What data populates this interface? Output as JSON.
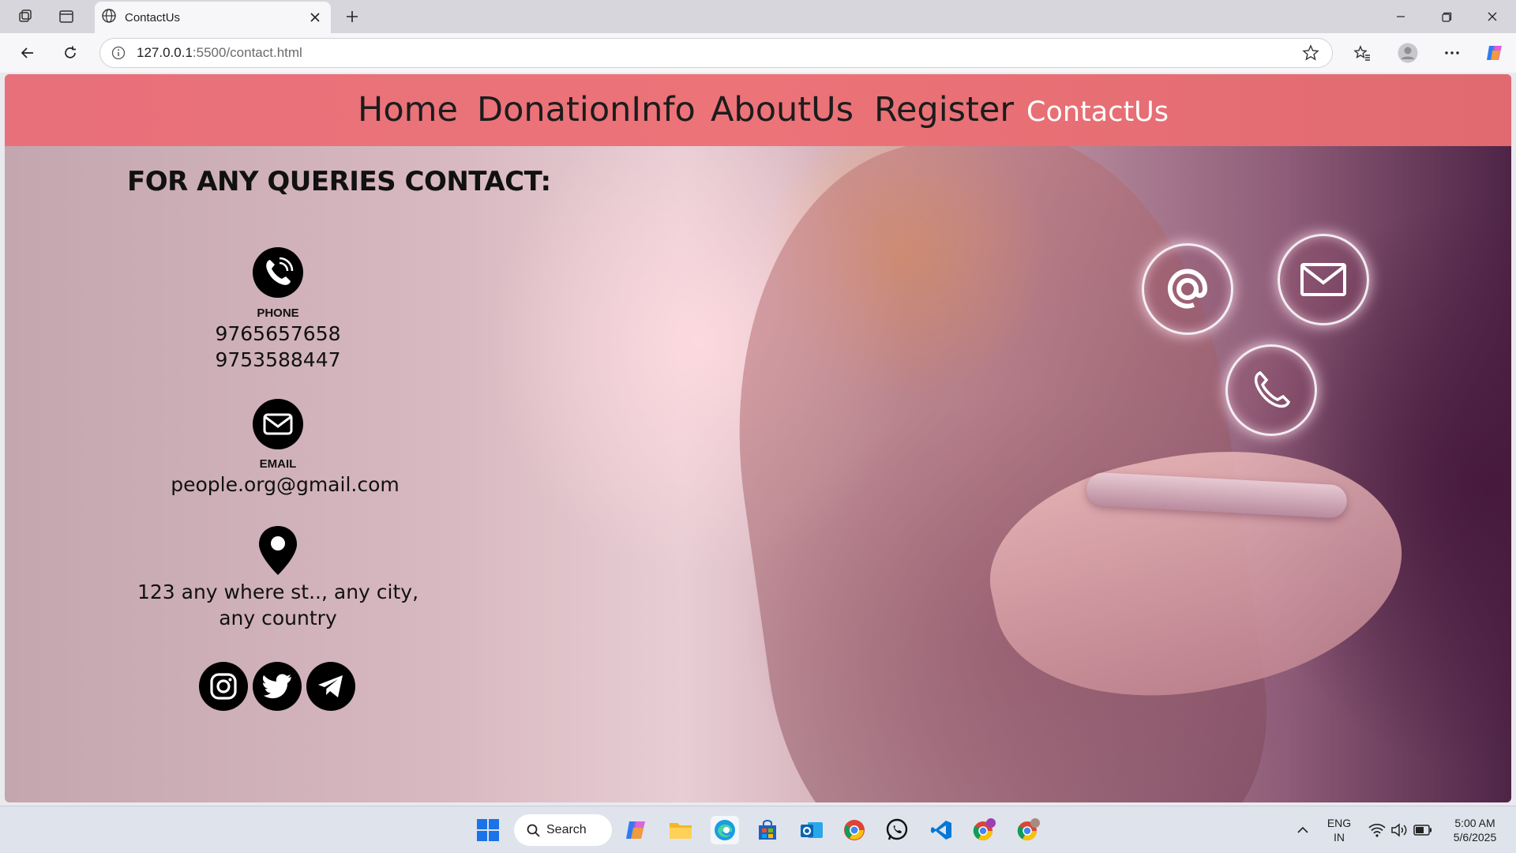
{
  "browser": {
    "tab_title": "ContactUs",
    "url_host": "127.0.0.1",
    "url_path": ":5500/contact.html"
  },
  "nav": {
    "items": [
      "Home",
      "DonationInfo",
      "AboutUs",
      "Register",
      "ContactUs"
    ],
    "active": "ContactUs"
  },
  "contact": {
    "heading": "FOR ANY QUERIES CONTACT:",
    "phone_label": "PHONE",
    "phones": [
      "9765657658",
      "9753588447"
    ],
    "email_label": "EMAIL",
    "email": "people.org@gmail.com",
    "address_line1": "123 any where st.., any city,",
    "address_line2": "any country"
  },
  "social": [
    "instagram-icon",
    "twitter-icon",
    "telegram-icon"
  ],
  "taskbar": {
    "search_label": "Search",
    "lang_line1": "ENG",
    "lang_line2": "IN",
    "time": "5:00 AM",
    "date": "5/6/2025"
  },
  "colors": {
    "navbar": "#ec7378",
    "active_nav": "#ffffff",
    "taskbar": "#dfe3ec"
  }
}
